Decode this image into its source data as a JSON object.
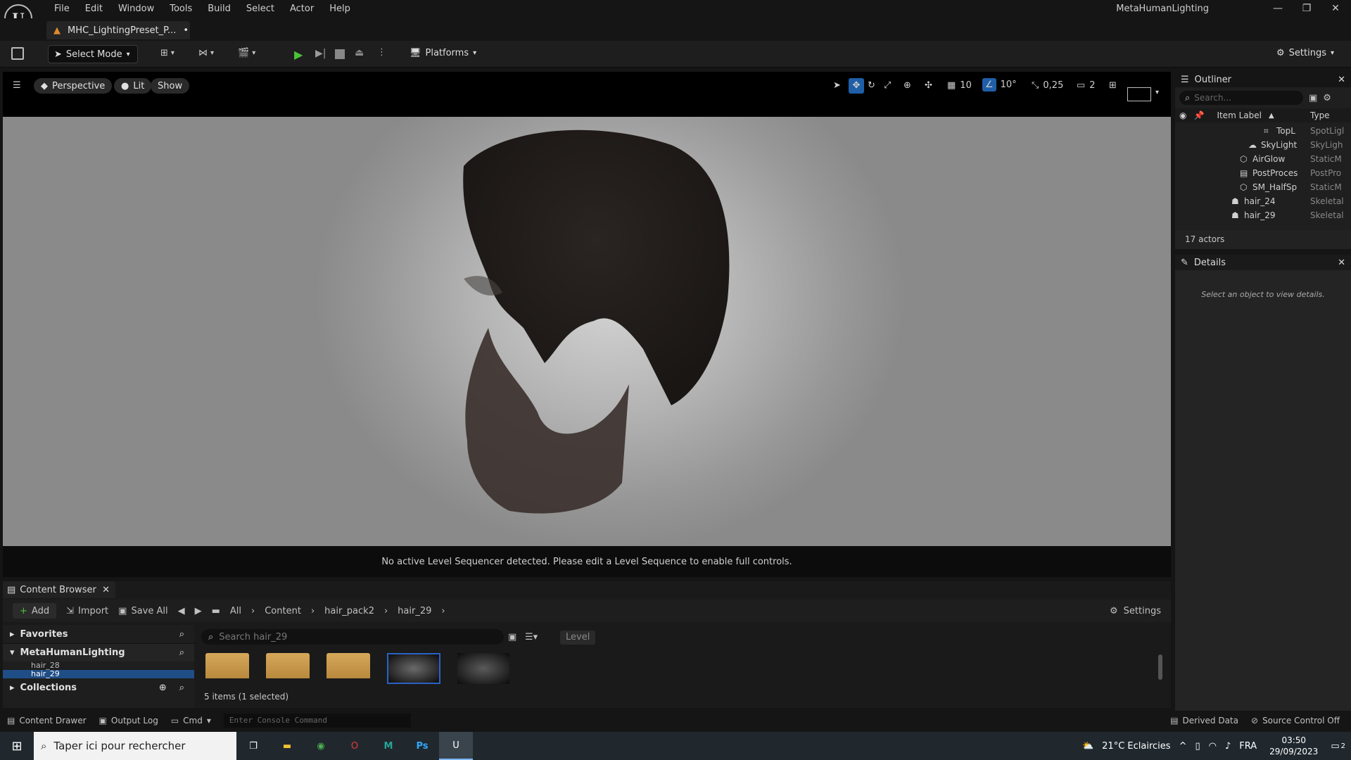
{
  "app": {
    "logo_letter": "U",
    "menu": [
      "File",
      "Edit",
      "Window",
      "Tools",
      "Build",
      "Select",
      "Actor",
      "Help"
    ],
    "title": "MetaHumanLighting",
    "level_tab": "MHC_LightingPreset_P...",
    "level_tab_modified": "•"
  },
  "toolbar": {
    "select_mode": "Select Mode",
    "platforms": "Platforms",
    "settings": "Settings"
  },
  "viewport": {
    "perspective": "Perspective",
    "lit": "Lit",
    "show": "Show",
    "grid_snap": "10",
    "rotation_snap": "10°",
    "scale_snap": "0,25",
    "camera_speed": "2",
    "sequencer_message": "No active Level Sequencer detected. Please edit a Level Sequence to enable full controls."
  },
  "outliner": {
    "title": "Outliner",
    "search_placeholder": "Search...",
    "col_label": "Item Label",
    "col_type": "Type",
    "rows": [
      {
        "label": "TopL",
        "type": "SpotLigl"
      },
      {
        "label": "SkyLight",
        "type": "SkyLigh"
      },
      {
        "label": "AirGlow",
        "type": "StaticM"
      },
      {
        "label": "PostProces",
        "type": "PostPro"
      },
      {
        "label": "SM_HalfSp",
        "type": "StaticM"
      },
      {
        "label": "hair_24",
        "type": "Skeletal"
      },
      {
        "label": "hair_29",
        "type": "Skeletal"
      }
    ],
    "count": "17 actors"
  },
  "details": {
    "title": "Details",
    "empty": "Select an object to view details."
  },
  "content_browser": {
    "tab": "Content Browser",
    "add": "Add",
    "import": "Import",
    "save_all": "Save All",
    "breadcrumb": [
      "All",
      "Content",
      "hair_pack2",
      "hair_29"
    ],
    "settings": "Settings",
    "favorites": "Favorites",
    "project": "MetaHumanLighting",
    "tree_items": [
      "hair_28",
      "hair_29"
    ],
    "collections": "Collections",
    "search_placeholder": "Search hair_29",
    "filter_chip": "Level",
    "status": "5 items (1 selected)"
  },
  "statusbar": {
    "content_drawer": "Content Drawer",
    "output_log": "Output Log",
    "cmd": "Cmd",
    "console_placeholder": "Enter Console Command",
    "derived_data": "Derived Data",
    "source_control": "Source Control Off"
  },
  "taskbar": {
    "search_placeholder": "Taper ici pour rechercher",
    "weather": "21°C  Eclaircies",
    "language": "FRA",
    "time": "03:50",
    "date": "29/09/2023",
    "notifications": "2"
  }
}
